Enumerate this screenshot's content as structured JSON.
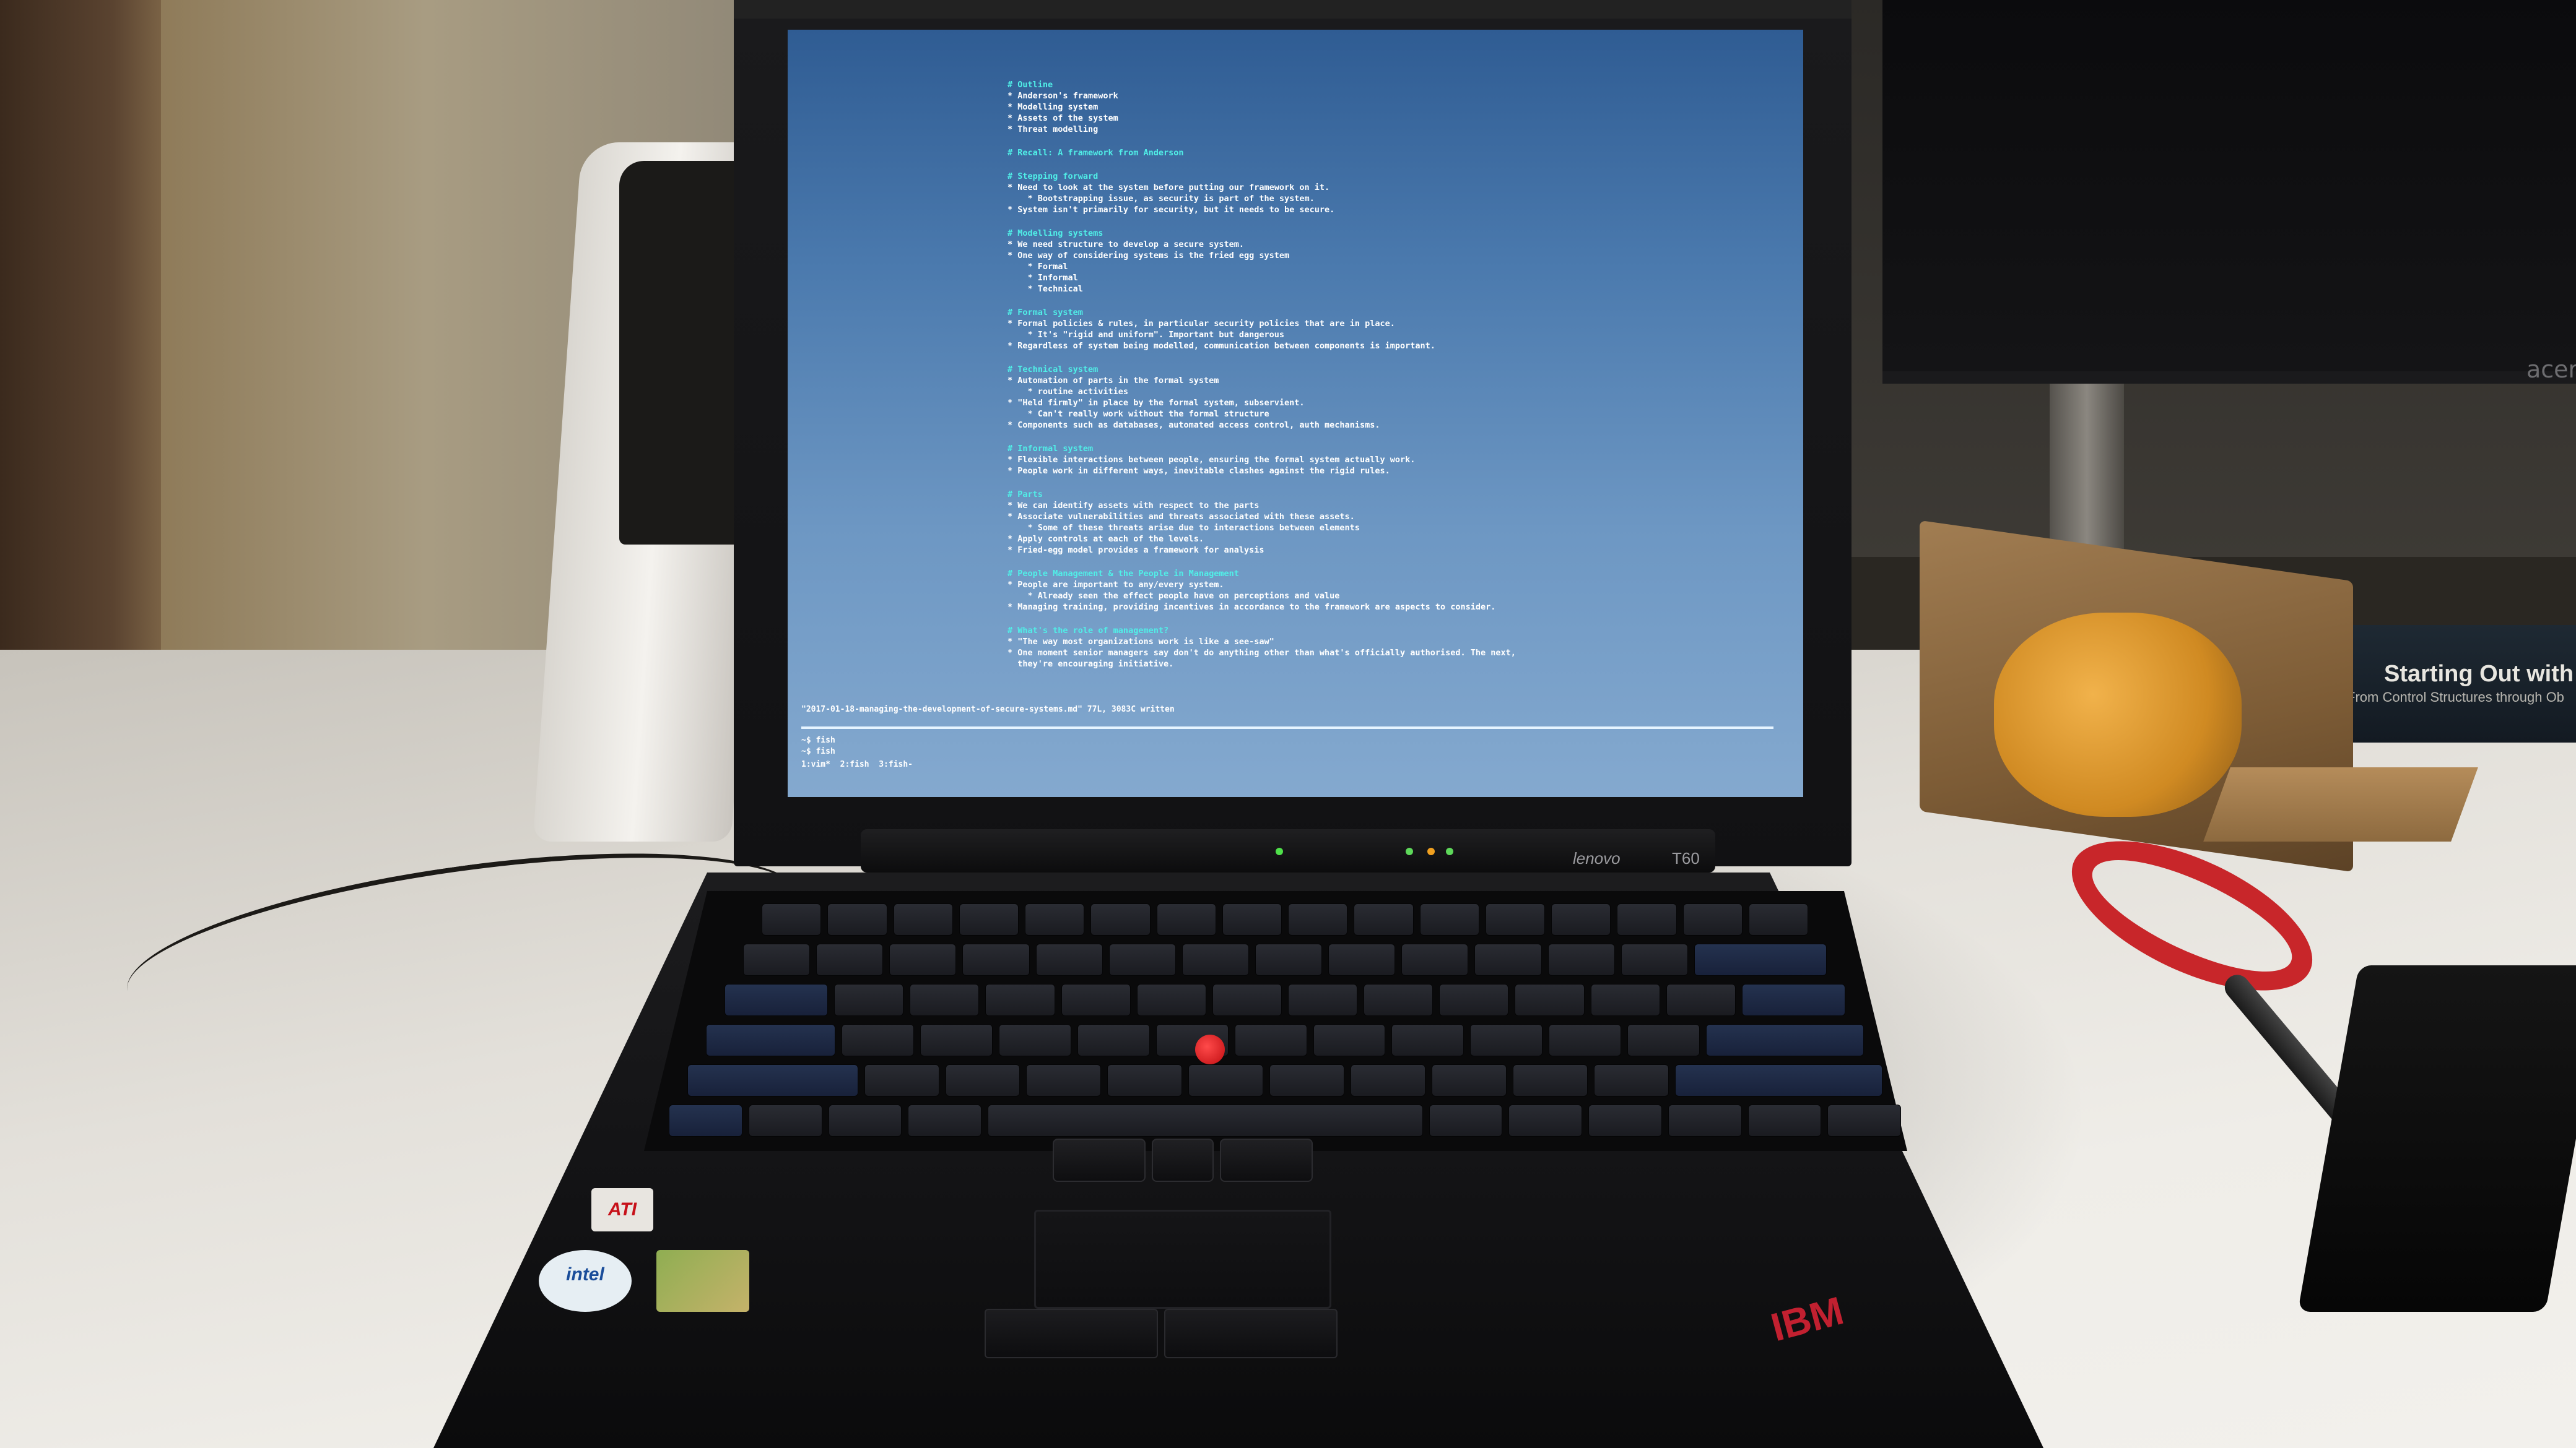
{
  "terminal": {
    "sections": [
      {
        "heading": "# Outline",
        "lines": [
          "* Anderson's framework",
          "* Modelling system",
          "* Assets of the system",
          "* Threat modelling"
        ]
      },
      {
        "heading": "# Recall: A framework from Anderson",
        "lines": []
      },
      {
        "heading": "# Stepping forward",
        "lines": [
          "* Need to look at the system before putting our framework on it.",
          "    * Bootstrapping issue, as security is part of the system.",
          "* System isn't primarily for security, but it needs to be secure."
        ]
      },
      {
        "heading": "# Modelling systems",
        "lines": [
          "* We need structure to develop a secure system.",
          "* One way of considering systems is the fried egg system",
          "    * Formal",
          "    * Informal",
          "    * Technical"
        ]
      },
      {
        "heading": "# Formal system",
        "lines": [
          "* Formal policies & rules, in particular security policies that are in place.",
          "    * It's \"rigid and uniform\". Important but dangerous",
          "* Regardless of system being modelled, communication between components is important."
        ]
      },
      {
        "heading": "# Technical system",
        "lines": [
          "* Automation of parts in the formal system",
          "    * routine activities",
          "* \"Held firmly\" in place by the formal system, subservient.",
          "    * Can't really work without the formal structure",
          "* Components such as databases, automated access control, auth mechanisms."
        ]
      },
      {
        "heading": "# Informal system",
        "lines": [
          "* Flexible interactions between people, ensuring the formal system actually work.",
          "* People work in different ways, inevitable clashes against the rigid rules."
        ]
      },
      {
        "heading": "# Parts",
        "lines": [
          "* We can identify assets with respect to the parts",
          "* Associate vulnerabilities and threats associated with these assets.",
          "    * Some of these threats arise due to interactions between elements",
          "* Apply controls at each of the levels.",
          "* Fried-egg model provides a framework for analysis"
        ]
      },
      {
        "heading": "# People Management & the People in Management",
        "lines": [
          "* People are important to any/every system.",
          "    * Already seen the effect people have on perceptions and value",
          "* Managing training, providing incentives in accordance to the framework are aspects to consider."
        ]
      },
      {
        "heading": "# What's the role of management?",
        "lines": [
          "* \"The way most organizations work is like a see-saw\"",
          "* One moment senior managers say don't do anything other than what's officially authorised. The next,",
          "  they're encouraging initiative."
        ]
      }
    ],
    "status_line": "\"2017-01-18-managing-the-development-of-secure-systems.md\" 77L, 3083C written",
    "pane_lines": [
      "~$ fish",
      "~$ fish"
    ],
    "tmux_bar": "1:vim*  2:fish  3:fish-"
  },
  "laptop": {
    "brand": "lenovo",
    "model": "T60",
    "ibm_logo": "IBM",
    "sticker_ati": "ATI",
    "sticker_intel": "intel"
  },
  "monitor": {
    "brand": "acer"
  },
  "book": {
    "title": "Starting Out with C++",
    "subtitle": "From Control Structures through Ob"
  }
}
